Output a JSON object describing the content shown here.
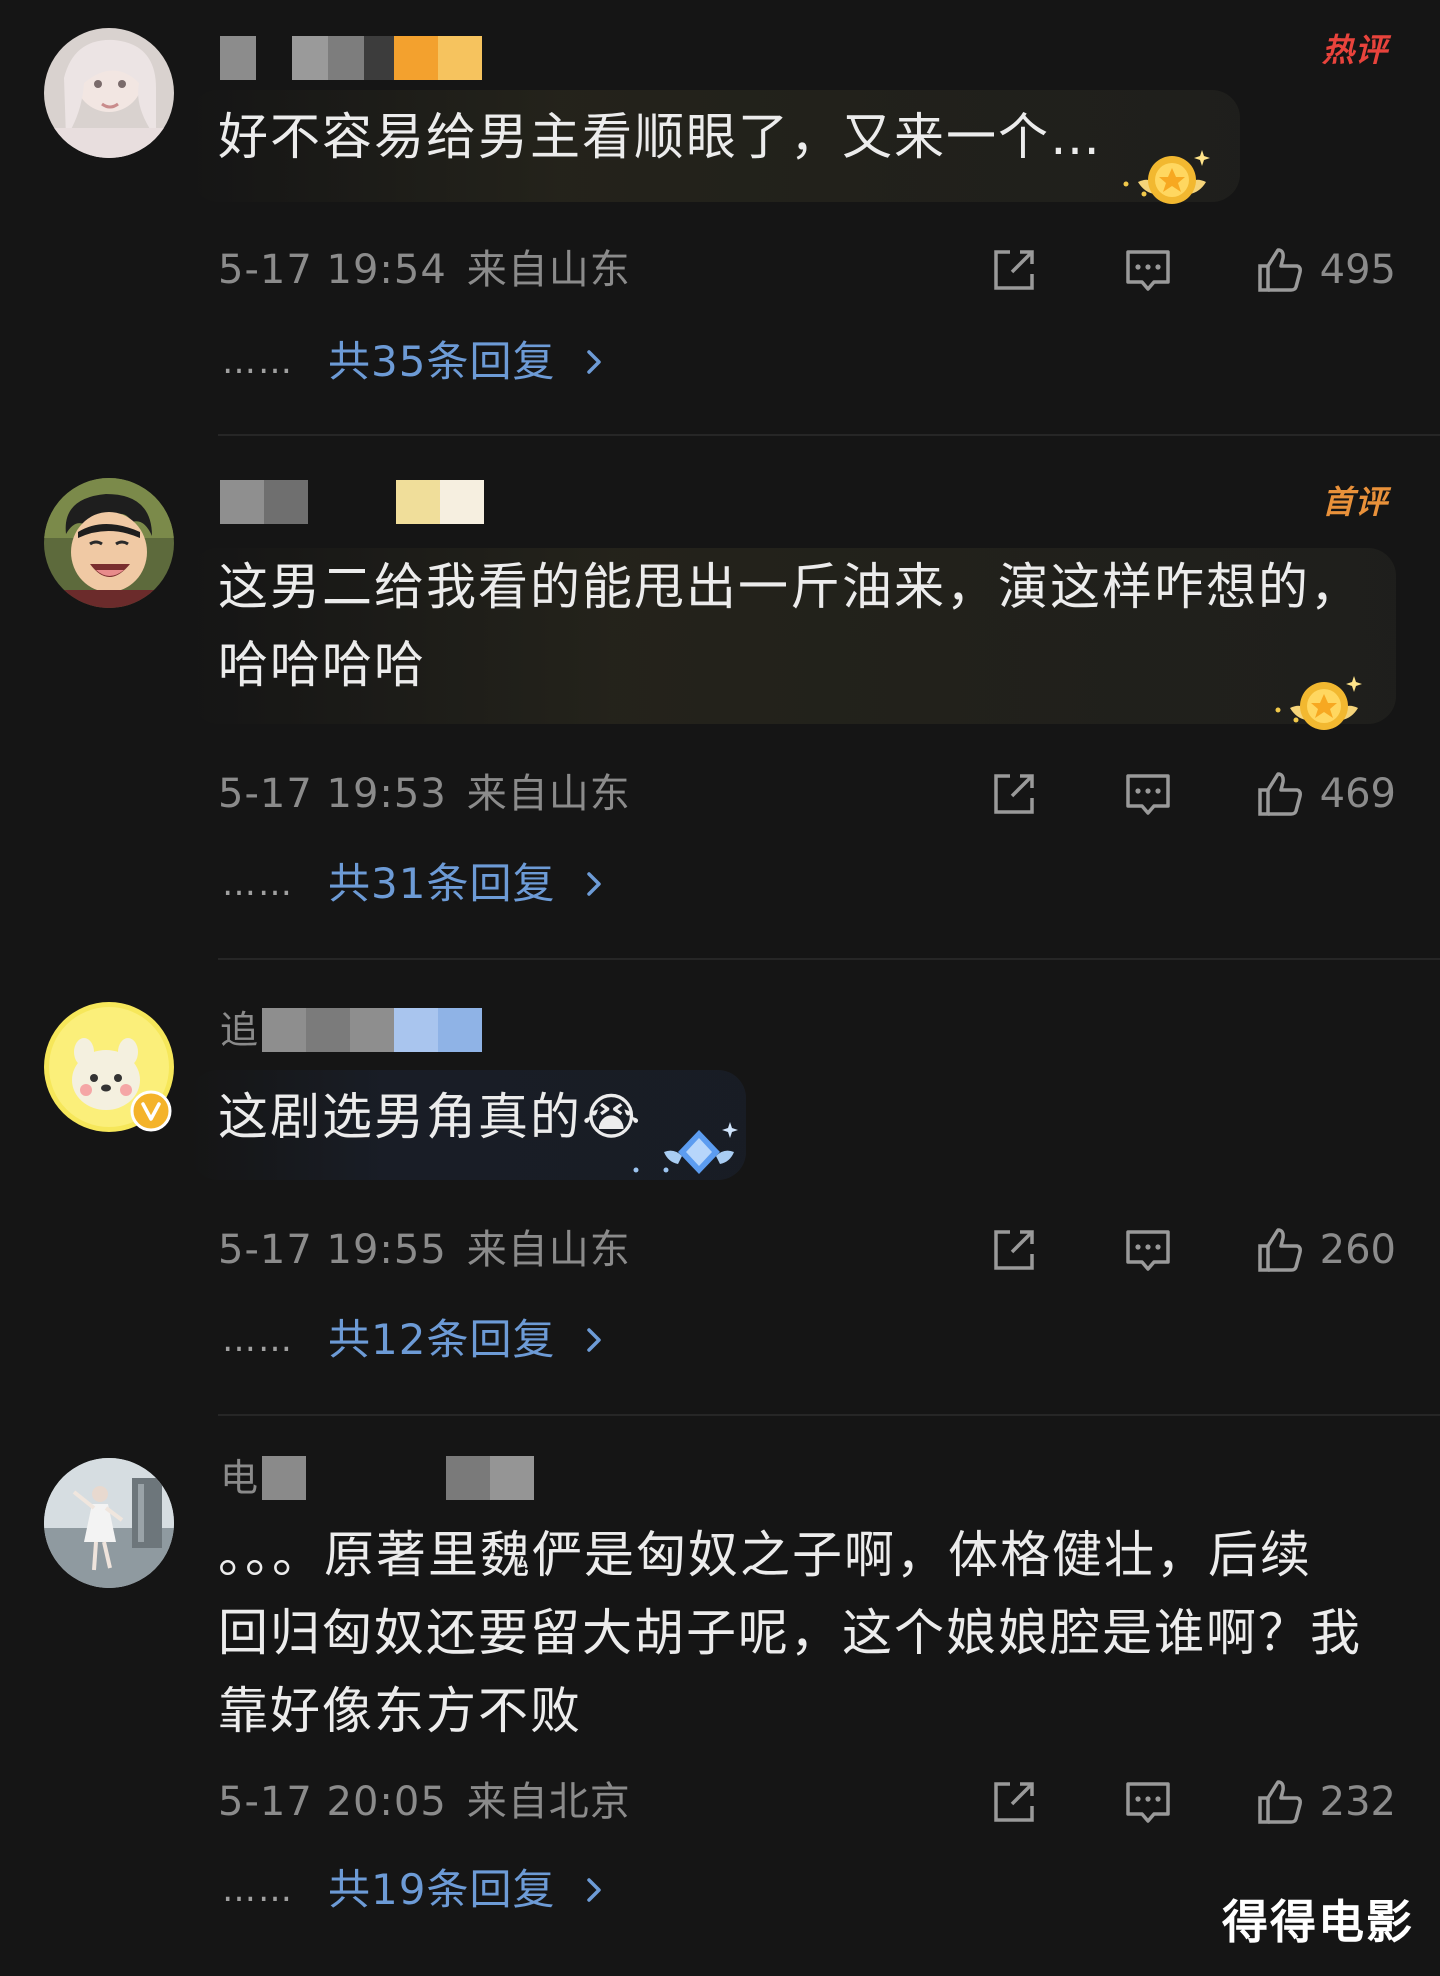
{
  "comments": [
    {
      "badge": "热评",
      "content": "好不容易给男主看顺眼了，又来一个…",
      "time": "5-17 19:54",
      "location": "来自山东",
      "likes": "495",
      "replies": "共35条回复",
      "avatar_icon": "avatar-girl-portrait",
      "medal_icon": "gold-medal-icon"
    },
    {
      "badge": "首评",
      "content": "这男二给我看的能甩出一斤油来，演这样咋想的，\n哈哈哈哈",
      "time": "5-17 19:53",
      "location": "来自山东",
      "likes": "469",
      "replies": "共31条回复",
      "avatar_icon": "avatar-anime-boy",
      "medal_icon": "gold-medal-icon"
    },
    {
      "name_prefix": "追",
      "content": "这剧选男角真的😭",
      "time": "5-17 19:55",
      "location": "来自山东",
      "likes": "260",
      "replies": "共12条回复",
      "avatar_icon": "avatar-yellow-cartoon-verified",
      "medal_icon": "blue-diamond-medal-icon"
    },
    {
      "name_prefix": "电",
      "content": "。。。原著里魏俨是匈奴之子啊，体格健壮，后续\n回归匈奴还要留大胡子呢，这个娘娘腔是谁啊？我\n靠好像东方不败",
      "time": "5-17 20:05",
      "location": "来自北京",
      "likes": "232",
      "replies": "共19条回复",
      "avatar_icon": "avatar-dancer-photo"
    }
  ],
  "more_dots": "……",
  "watermark": "得得电影",
  "colors": {
    "background": "#151515",
    "link": "#6d9bd6",
    "hot_badge": "#e8433c",
    "first_badge": "#e9913a",
    "meta": "#8b8b8b"
  },
  "icons": {
    "share": "share-icon",
    "comment": "comment-icon",
    "like": "thumbs-up-icon",
    "chevron": "chevron-right-icon"
  }
}
